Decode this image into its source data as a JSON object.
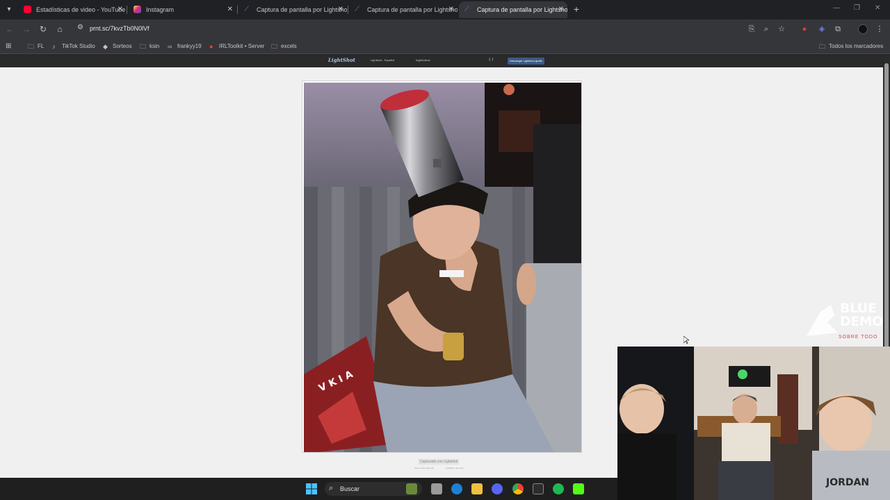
{
  "browser": {
    "tabs": [
      {
        "title": "Estadísticas de video - YouTube",
        "favicon": "youtube-icon",
        "color": "#ff0033",
        "active": false
      },
      {
        "title": "Instagram",
        "favicon": "instagram-icon",
        "color": "#e1306c",
        "active": false
      },
      {
        "title": "Captura de pantalla por Lightshot",
        "favicon": "lightshot-feather-icon",
        "color": "#9b6bd6",
        "active": false
      },
      {
        "title": "Captura de pantalla por Lightshot",
        "favicon": "lightshot-feather-icon",
        "color": "#9b6bd6",
        "active": false
      },
      {
        "title": "Captura de pantalla por Lightshot",
        "favicon": "lightshot-feather-icon",
        "color": "#9b6bd6",
        "active": true
      }
    ],
    "close_glyph": "✕",
    "new_tab_glyph": "+",
    "url": "prnt.sc/7kvzTb0N0lVf",
    "bookmarks": [
      {
        "label": "FL",
        "icon": "folder-icon"
      },
      {
        "label": "TikTok Studio",
        "icon": "tiktok-icon"
      },
      {
        "label": "Sorteos",
        "icon": "diamond-icon"
      },
      {
        "label": "ksin",
        "icon": "folder-icon"
      },
      {
        "label": "frankyy19",
        "icon": "link-icon"
      },
      {
        "label": "IRLToolkit • Server",
        "icon": "irltoolkit-icon"
      },
      {
        "label": "excels",
        "icon": "folder-icon"
      }
    ],
    "all_bookmarks": "Todos los marcadores"
  },
  "lightshot": {
    "logo": "LightShot",
    "nav_links": [
      "Lightshot - Español",
      "Inglés/otros"
    ],
    "download_button": "Descargar Lightshot gratis",
    "caption": "Capturado con Lightshot",
    "caption_links": [
      "antes: otras capturas",
      "Lightshot: sitio web"
    ]
  },
  "photo": {
    "sign_letters": "V K I A"
  },
  "overlay": {
    "brand_line1": "BLUE",
    "brand_line2": "DEMON",
    "brand_sub": "SOBRE TODO"
  },
  "taskbar": {
    "search_label": "Buscar"
  },
  "colors": {
    "accent_blue": "#8ab4f8",
    "page_bg": "#f0f0f0",
    "taskbar_bg": "#1f1f1f"
  }
}
